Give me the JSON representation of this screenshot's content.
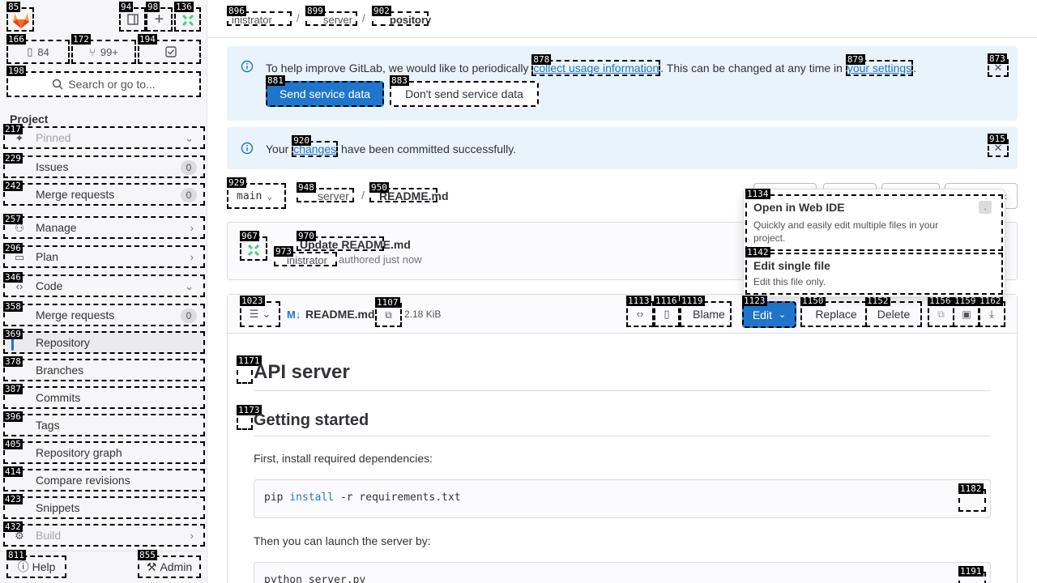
{
  "sidebar": {
    "counts": {
      "issues_badge": "84",
      "mr_badge": "99+"
    },
    "search_placeholder": "Search or go to...",
    "project_heading": "Project",
    "pinned": "Pinned",
    "items": [
      {
        "label": "Issues",
        "count": "0"
      },
      {
        "label": "Merge requests",
        "count": "0"
      },
      {
        "label": "Manage"
      },
      {
        "label": "Plan"
      },
      {
        "label": "Code"
      },
      {
        "label": "Merge requests",
        "count": "0"
      },
      {
        "label": "Repository"
      },
      {
        "label": "Branches"
      },
      {
        "label": "Commits"
      },
      {
        "label": "Tags"
      },
      {
        "label": "Repository graph"
      },
      {
        "label": "Compare revisions"
      },
      {
        "label": "Snippets"
      },
      {
        "label": "Build"
      }
    ],
    "help": "Help",
    "admin": "Admin"
  },
  "breadcrumb": {
    "part1": "inistrator",
    "part2": "server",
    "part3": "pository"
  },
  "alert1": {
    "text_before": "To help improve GitLab, we would like to periodically",
    "link1": "collect usage information",
    "text_middle": ". This can be changed at any time in",
    "link2": "your settings",
    "text_after": ".",
    "primary_btn": "Send service data",
    "secondary_btn": "Don't send service data"
  },
  "alert2": {
    "before": "Your",
    "link": "changes",
    "after": "have been committed successfully."
  },
  "repo": {
    "branch": "main",
    "path1": "server",
    "path2": "README.md",
    "commit_title": "Update README.md",
    "commit_author": "inistrator",
    "commit_meta": "authored just now"
  },
  "file": {
    "name": "README.md",
    "size": "2.18 KiB",
    "blame": "Blame",
    "edit": "Edit",
    "replace": "Replace",
    "delete": "Delete"
  },
  "dropdown": {
    "open_ide_title": "Open in Web IDE",
    "open_ide_shortcut": ".",
    "open_ide_desc": "Quickly and easily edit multiple files in your project.",
    "edit_single_title": "Edit single file",
    "edit_single_desc": "Edit this file only."
  },
  "readme": {
    "h1": "API server",
    "h2": "Getting started",
    "p1": "First, install required dependencies:",
    "code1_cmd": "pip",
    "code1_kw": "install",
    "code1_rest": "-r requirements.txt",
    "p2": "Then you can launch the server by:",
    "code2": "python server.py"
  },
  "colors": {
    "accent": "#1f75cb",
    "alert_bg": "#e9f3fc"
  }
}
